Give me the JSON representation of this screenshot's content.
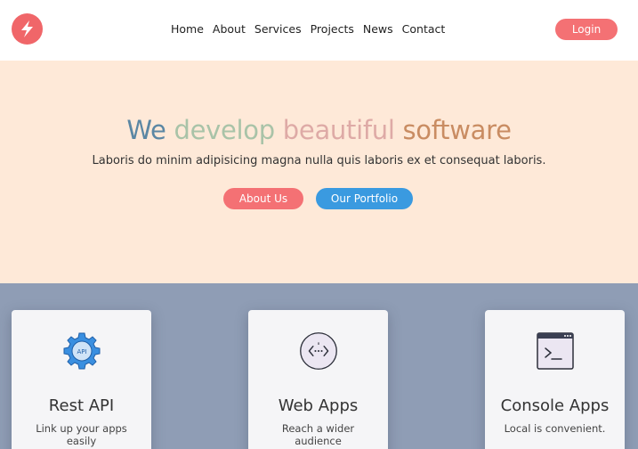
{
  "header": {
    "nav": [
      "Home",
      "About",
      "Services",
      "Projects",
      "News",
      "Contact"
    ],
    "login_label": "Login"
  },
  "hero": {
    "title_words": [
      {
        "text": "We",
        "color": "#5b87a4"
      },
      {
        "text": "develop",
        "color": "#a9c3a8"
      },
      {
        "text": "beautiful",
        "color": "#deaaa6"
      },
      {
        "text": "software",
        "color": "#c98c62"
      }
    ],
    "subtitle": "Laboris do minim adipisicing magna nulla quis laboris ex et consequat laboris.",
    "about_label": "About Us",
    "portfolio_label": "Our Portfolio"
  },
  "services": [
    {
      "title": "Rest API",
      "description": "Link up your apps easily",
      "icon": "api-gear-icon"
    },
    {
      "title": "Web Apps",
      "description": "Reach a wider audience",
      "icon": "web-code-icon"
    },
    {
      "title": "Console Apps",
      "description": "Local is convenient.",
      "icon": "terminal-icon"
    }
  ],
  "colors": {
    "brand": "#f06669",
    "hero_bg": "#fee9d8",
    "services_bg": "#8f9db5",
    "portfolio_button": "#3a9ae0"
  }
}
